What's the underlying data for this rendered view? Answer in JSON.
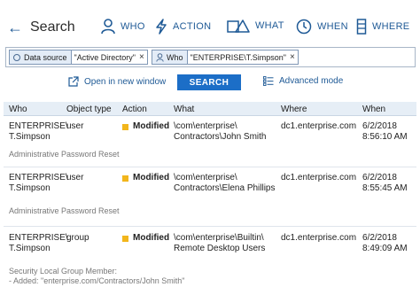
{
  "header": {
    "back_icon": "arrow-left-icon",
    "title": "Search",
    "nav": [
      {
        "label": "WHO",
        "icon": "person-icon"
      },
      {
        "label": "ACTION",
        "icon": "lightning-icon"
      },
      {
        "label": "WHAT",
        "icon": "shapes-icon"
      },
      {
        "label": "WHEN",
        "icon": "clock-icon"
      },
      {
        "label": "WHERE",
        "icon": "server-icon"
      }
    ]
  },
  "filters": [
    {
      "key": "Data source",
      "value": "\"Active Directory\"",
      "icon": "circle-icon"
    },
    {
      "key": "Who",
      "value": "\"ENTERPRISE\\T.Simpson\"",
      "icon": "person-icon"
    }
  ],
  "actions": {
    "open_new_window": "Open in new window",
    "search": "SEARCH",
    "advanced_mode": "Advanced mode"
  },
  "table": {
    "columns": [
      "Who",
      "Object type",
      "Action",
      "What",
      "Where",
      "When"
    ],
    "rows": [
      {
        "who": [
          "ENTERPRISE\\",
          "T.Simpson"
        ],
        "object_type": "user",
        "action": "Modified",
        "what": [
          "\\com\\enterprise\\",
          "Contractors\\John Smith"
        ],
        "where": "dc1.enterprise.com",
        "when": [
          "6/2/2018",
          "8:56:10 AM"
        ],
        "detail": [
          "Administrative Password Reset"
        ]
      },
      {
        "who": [
          "ENTERPRISE\\",
          "T.Simpson"
        ],
        "object_type": "user",
        "action": "Modified",
        "what": [
          "\\com\\enterprise\\",
          "Contractors\\Elena Phillips"
        ],
        "where": "dc1.enterprise.com",
        "when": [
          "6/2/2018",
          "8:55:45 AM"
        ],
        "detail": [
          "Administrative Password Reset"
        ]
      },
      {
        "who": [
          "ENTERPRISE\\",
          "T.Simpson"
        ],
        "object_type": "group",
        "action": "Modified",
        "what": [
          "\\com\\enterprise\\Builtin\\",
          "Remote Desktop Users"
        ],
        "where": "dc1.enterprise.com",
        "when": [
          "6/2/2018",
          "8:49:09 AM"
        ],
        "detail": [
          "Security Local Group Member:",
          "- Added: \"enterprise.com/Contractors/John Smith\""
        ]
      }
    ]
  },
  "colors": {
    "accent": "#1f5a96",
    "button": "#1c6ec7",
    "header_bg": "#e6eef6",
    "modified_marker": "#f2b61c"
  }
}
